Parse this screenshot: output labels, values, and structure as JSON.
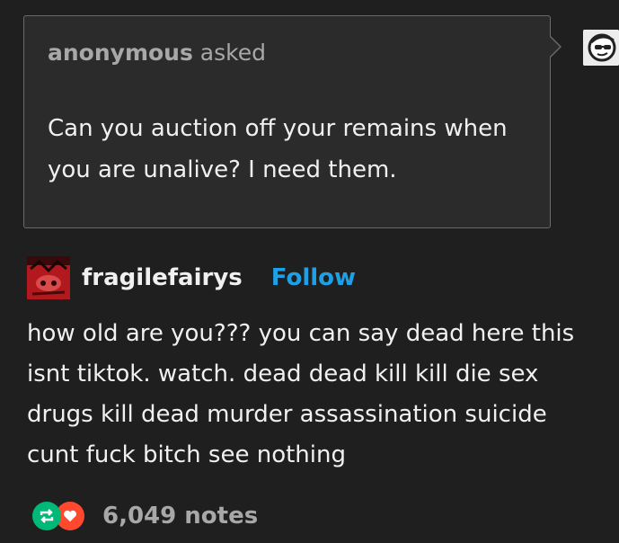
{
  "ask": {
    "asker": "anonymous",
    "asked_label": "asked",
    "question": "Can you auction off your remains when you are unalive? I need them."
  },
  "post": {
    "username": "fragilefairys",
    "follow_label": "Follow",
    "body": "how old are you??? you can say dead here this isnt tiktok. watch. dead dead kill kill die sex drugs kill dead murder assassination suicide cunt fuck bitch see nothing"
  },
  "notes": {
    "count": "6,049 notes",
    "reblog_icon": "reblog-icon",
    "like_icon": "heart-icon",
    "reblog_color": "#00b877",
    "like_color": "#ff492f"
  },
  "colors": {
    "background": "#1f1f1f",
    "follow": "#1fa0e6",
    "muted_text": "#a8a8a8"
  }
}
